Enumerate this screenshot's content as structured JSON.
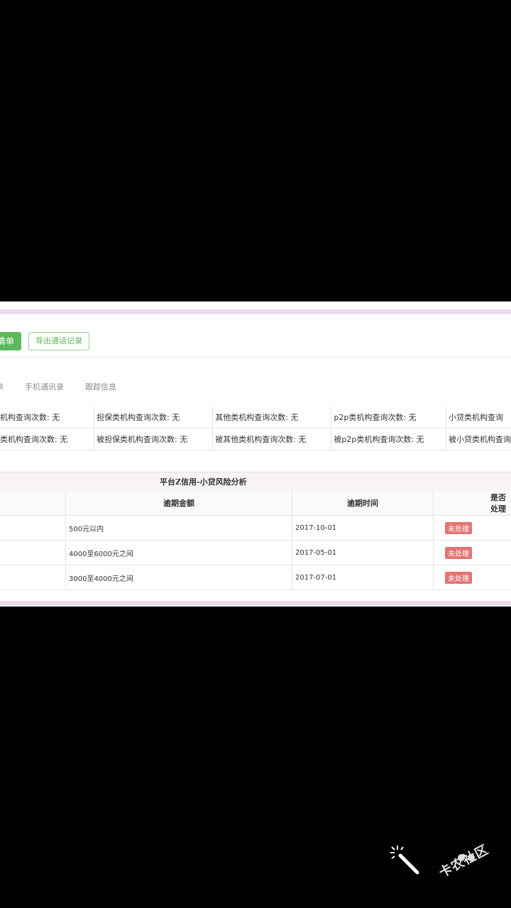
{
  "toolbar": {
    "green_button_label": "清单",
    "export_calls_label": "导出通话记录"
  },
  "tabs": [
    {
      "label": "单"
    },
    {
      "label": "手机通讯录"
    },
    {
      "label": "跟踪信息"
    }
  ],
  "query_grid": {
    "rows": [
      [
        "机构查询次数: 无",
        "担保类机构查询次数: 无",
        "其他类机构查询次数: 无",
        "p2p类机构查询次数: 无",
        "小贷类机构查询"
      ],
      [
        "类机构查询次数: 无",
        "被担保类机构查询次数: 无",
        "被其他类机构查询次数: 无",
        "被p2p类机构查询次数: 无",
        "被小贷类机构查询"
      ]
    ]
  },
  "risk": {
    "title": "平台Z信用-小贷风险分析",
    "headers": [
      "",
      "逾期金额",
      "逾期时间",
      "是否处理"
    ],
    "rows": [
      {
        "amount": "500元以内",
        "date": "2017-10-01",
        "status": "未处理"
      },
      {
        "amount": "4000至6000元之间",
        "date": "2017-05-01",
        "status": "未处理"
      },
      {
        "amount": "3000至4000元之间",
        "date": "2017-07-01",
        "status": "未处理"
      }
    ]
  },
  "watermark": {
    "text": "卡农社区"
  },
  "colors": {
    "accent_green": "#5cb85c",
    "status_red": "#e57373",
    "strip": "#e8dde8"
  }
}
